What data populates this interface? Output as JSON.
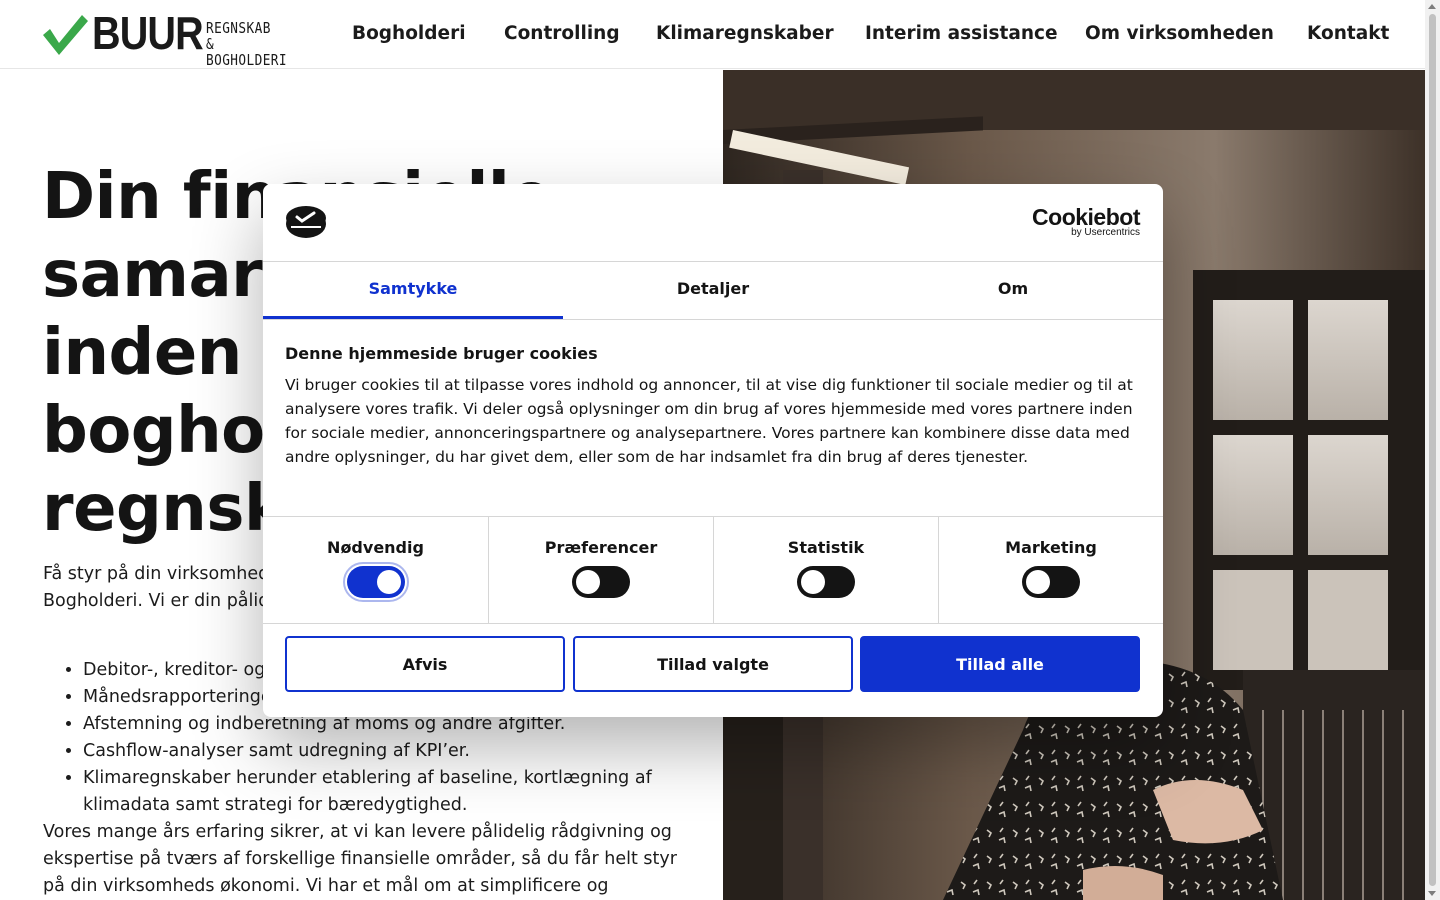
{
  "header": {
    "logo": {
      "brand": "BUUR",
      "sub_line1": "REGNSKAB",
      "sub_line2": "& BOGHOLDERI"
    },
    "nav": [
      "Bogholderi",
      "Controlling",
      "Klimaregnskaber",
      "Interim assistance",
      "Om virksomheden",
      "Kontakt"
    ]
  },
  "hero": {
    "title": "Din finansielle samarbejdspartner inden for bogholderi og regnskab",
    "intro": "Få styr på din virksomheds økonomi med hjælp fra Buur Regnskab & Bogholderi. Vi er din pålidelige samarbejdspartner med",
    "list": [
      "Debitor-, kreditor- og lønbogholderi.",
      "Månedsrapporteringer og budgetter.",
      "Afstemning og indberetning af moms og andre afgifter.",
      "Cashflow-analyser samt udregning af KPI’er.",
      "Klimaregnskaber herunder etablering af baseline, kortlægning af klimadata samt strategi for bæredygtighed."
    ],
    "after": "Vores mange års erfaring sikrer, at vi kan levere pålidelig rådgivning og ekspertise på tværs af forskellige finansielle områder, så du får helt styr på din virksomheds økonomi. Vi har et mål om at simplificere og"
  },
  "cookie_dialog": {
    "brand": "Cookiebot",
    "brand_sub": "by Usercentrics",
    "tabs": [
      "Samtykke",
      "Detaljer",
      "Om"
    ],
    "active_tab": "Samtykke",
    "title": "Denne hjemmeside bruger cookies",
    "text": "Vi bruger cookies til at tilpasse vores indhold og annoncer, til at vise dig funktioner til sociale medier og til at analysere vores trafik. Vi deler også oplysninger om din brug af vores hjemmeside med vores partnere inden for sociale medier, annonceringspartnere og analysepartnere. Vores partnere kan kombinere disse data med andre oplysninger, du har givet dem, eller som de har indsamlet fra din brug af deres tjenester.",
    "toggles": [
      {
        "label": "Nødvendig",
        "on": true
      },
      {
        "label": "Præferencer",
        "on": false
      },
      {
        "label": "Statistik",
        "on": false
      },
      {
        "label": "Marketing",
        "on": false
      }
    ],
    "buttons": {
      "reject": "Afvis",
      "allow_selected": "Tillad valgte",
      "allow_all": "Tillad alle"
    }
  },
  "colors": {
    "accent": "#1032cf",
    "logo_check": "#3aa84a"
  }
}
